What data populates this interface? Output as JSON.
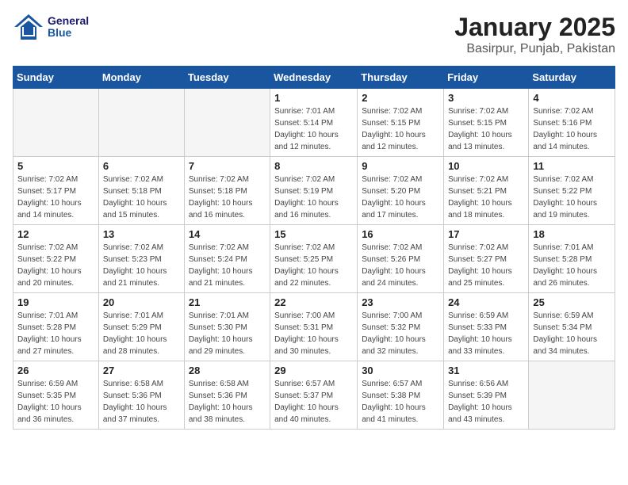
{
  "logo": {
    "line1": "General",
    "line2": "Blue"
  },
  "title": "January 2025",
  "subtitle": "Basirpur, Punjab, Pakistan",
  "days_of_week": [
    "Sunday",
    "Monday",
    "Tuesday",
    "Wednesday",
    "Thursday",
    "Friday",
    "Saturday"
  ],
  "weeks": [
    [
      {
        "day": "",
        "info": ""
      },
      {
        "day": "",
        "info": ""
      },
      {
        "day": "",
        "info": ""
      },
      {
        "day": "1",
        "info": "Sunrise: 7:01 AM\nSunset: 5:14 PM\nDaylight: 10 hours\nand 12 minutes."
      },
      {
        "day": "2",
        "info": "Sunrise: 7:02 AM\nSunset: 5:15 PM\nDaylight: 10 hours\nand 12 minutes."
      },
      {
        "day": "3",
        "info": "Sunrise: 7:02 AM\nSunset: 5:15 PM\nDaylight: 10 hours\nand 13 minutes."
      },
      {
        "day": "4",
        "info": "Sunrise: 7:02 AM\nSunset: 5:16 PM\nDaylight: 10 hours\nand 14 minutes."
      }
    ],
    [
      {
        "day": "5",
        "info": "Sunrise: 7:02 AM\nSunset: 5:17 PM\nDaylight: 10 hours\nand 14 minutes."
      },
      {
        "day": "6",
        "info": "Sunrise: 7:02 AM\nSunset: 5:18 PM\nDaylight: 10 hours\nand 15 minutes."
      },
      {
        "day": "7",
        "info": "Sunrise: 7:02 AM\nSunset: 5:18 PM\nDaylight: 10 hours\nand 16 minutes."
      },
      {
        "day": "8",
        "info": "Sunrise: 7:02 AM\nSunset: 5:19 PM\nDaylight: 10 hours\nand 16 minutes."
      },
      {
        "day": "9",
        "info": "Sunrise: 7:02 AM\nSunset: 5:20 PM\nDaylight: 10 hours\nand 17 minutes."
      },
      {
        "day": "10",
        "info": "Sunrise: 7:02 AM\nSunset: 5:21 PM\nDaylight: 10 hours\nand 18 minutes."
      },
      {
        "day": "11",
        "info": "Sunrise: 7:02 AM\nSunset: 5:22 PM\nDaylight: 10 hours\nand 19 minutes."
      }
    ],
    [
      {
        "day": "12",
        "info": "Sunrise: 7:02 AM\nSunset: 5:22 PM\nDaylight: 10 hours\nand 20 minutes."
      },
      {
        "day": "13",
        "info": "Sunrise: 7:02 AM\nSunset: 5:23 PM\nDaylight: 10 hours\nand 21 minutes."
      },
      {
        "day": "14",
        "info": "Sunrise: 7:02 AM\nSunset: 5:24 PM\nDaylight: 10 hours\nand 21 minutes."
      },
      {
        "day": "15",
        "info": "Sunrise: 7:02 AM\nSunset: 5:25 PM\nDaylight: 10 hours\nand 22 minutes."
      },
      {
        "day": "16",
        "info": "Sunrise: 7:02 AM\nSunset: 5:26 PM\nDaylight: 10 hours\nand 24 minutes."
      },
      {
        "day": "17",
        "info": "Sunrise: 7:02 AM\nSunset: 5:27 PM\nDaylight: 10 hours\nand 25 minutes."
      },
      {
        "day": "18",
        "info": "Sunrise: 7:01 AM\nSunset: 5:28 PM\nDaylight: 10 hours\nand 26 minutes."
      }
    ],
    [
      {
        "day": "19",
        "info": "Sunrise: 7:01 AM\nSunset: 5:28 PM\nDaylight: 10 hours\nand 27 minutes."
      },
      {
        "day": "20",
        "info": "Sunrise: 7:01 AM\nSunset: 5:29 PM\nDaylight: 10 hours\nand 28 minutes."
      },
      {
        "day": "21",
        "info": "Sunrise: 7:01 AM\nSunset: 5:30 PM\nDaylight: 10 hours\nand 29 minutes."
      },
      {
        "day": "22",
        "info": "Sunrise: 7:00 AM\nSunset: 5:31 PM\nDaylight: 10 hours\nand 30 minutes."
      },
      {
        "day": "23",
        "info": "Sunrise: 7:00 AM\nSunset: 5:32 PM\nDaylight: 10 hours\nand 32 minutes."
      },
      {
        "day": "24",
        "info": "Sunrise: 6:59 AM\nSunset: 5:33 PM\nDaylight: 10 hours\nand 33 minutes."
      },
      {
        "day": "25",
        "info": "Sunrise: 6:59 AM\nSunset: 5:34 PM\nDaylight: 10 hours\nand 34 minutes."
      }
    ],
    [
      {
        "day": "26",
        "info": "Sunrise: 6:59 AM\nSunset: 5:35 PM\nDaylight: 10 hours\nand 36 minutes."
      },
      {
        "day": "27",
        "info": "Sunrise: 6:58 AM\nSunset: 5:36 PM\nDaylight: 10 hours\nand 37 minutes."
      },
      {
        "day": "28",
        "info": "Sunrise: 6:58 AM\nSunset: 5:36 PM\nDaylight: 10 hours\nand 38 minutes."
      },
      {
        "day": "29",
        "info": "Sunrise: 6:57 AM\nSunset: 5:37 PM\nDaylight: 10 hours\nand 40 minutes."
      },
      {
        "day": "30",
        "info": "Sunrise: 6:57 AM\nSunset: 5:38 PM\nDaylight: 10 hours\nand 41 minutes."
      },
      {
        "day": "31",
        "info": "Sunrise: 6:56 AM\nSunset: 5:39 PM\nDaylight: 10 hours\nand 43 minutes."
      },
      {
        "day": "",
        "info": ""
      }
    ]
  ]
}
